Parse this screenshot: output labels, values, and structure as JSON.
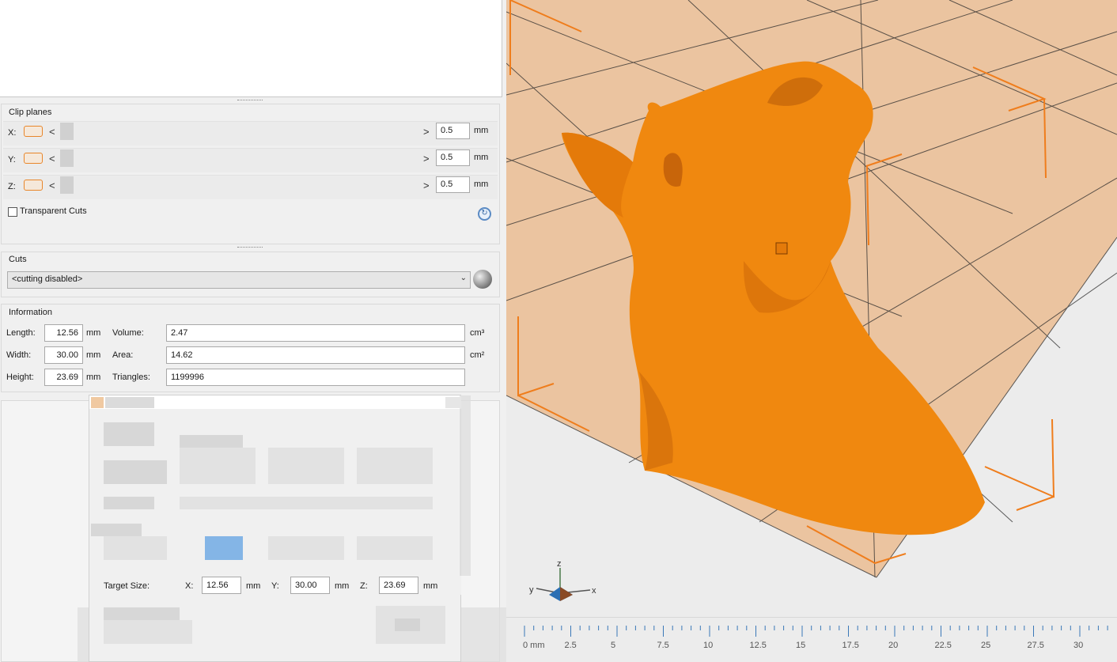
{
  "clip_planes": {
    "title": "Clip planes",
    "rows": [
      {
        "axis": "X:",
        "value": "0.5",
        "unit": "mm"
      },
      {
        "axis": "Y:",
        "value": "0.5",
        "unit": "mm"
      },
      {
        "axis": "Z:",
        "value": "0.5",
        "unit": "mm"
      }
    ],
    "transparent_label": "Transparent Cuts",
    "arrow_left": "<",
    "arrow_right": ">"
  },
  "cuts": {
    "title": "Cuts",
    "selected": "<cutting disabled>"
  },
  "information": {
    "title": "Information",
    "length_label": "Length:",
    "length": "12.56",
    "width_label": "Width:",
    "width": "30.00",
    "height_label": "Height:",
    "height": "23.69",
    "unit": "mm",
    "volume_label": "Volume:",
    "volume": "2.47",
    "volume_unit": "cm³",
    "area_label": "Area:",
    "area": "14.62",
    "area_unit": "cm²",
    "triangles_label": "Triangles:",
    "triangles": "1199996"
  },
  "scale_dialog": {
    "target_label": "Target Size:",
    "x_label": "X:",
    "x": "12.56",
    "y_label": "Y:",
    "y": "30.00",
    "z_label": "Z:",
    "z": "23.69",
    "unit": "mm"
  },
  "viewport": {
    "axis_labels": {
      "z": "z",
      "y": "y",
      "x": "x"
    },
    "ruler_labels": [
      "0 mm",
      "2.5",
      "5",
      "7.5",
      "10",
      "12.5",
      "15",
      "17.5",
      "20",
      "22.5",
      "25",
      "27.5",
      "30"
    ],
    "colors": {
      "model": "#f0880f",
      "bed": "#ebc4a0",
      "bbox": "#ef7d1c"
    }
  }
}
